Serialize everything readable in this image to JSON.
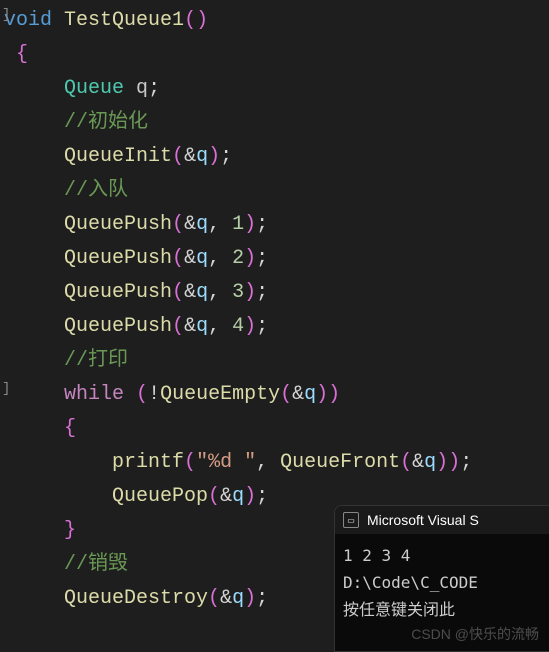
{
  "code": {
    "l1": {
      "kw": "void",
      "fn": "TestQueue1",
      "paren": "()"
    },
    "l2": "{",
    "l3": {
      "type": "Queue",
      "var": "q",
      "semi": ";"
    },
    "l4": "//初始化",
    "l5": {
      "fn": "QueueInit",
      "open": "(",
      "amp": "&",
      "arg": "q",
      "close": ")",
      "semi": ";"
    },
    "l6": "//入队",
    "l7": {
      "fn": "QueuePush",
      "open": "(",
      "amp": "&",
      "arg": "q",
      "comma": ", ",
      "n": "1",
      "close": ")",
      "semi": ";"
    },
    "l8": {
      "fn": "QueuePush",
      "open": "(",
      "amp": "&",
      "arg": "q",
      "comma": ", ",
      "n": "2",
      "close": ")",
      "semi": ";"
    },
    "l9": {
      "fn": "QueuePush",
      "open": "(",
      "amp": "&",
      "arg": "q",
      "comma": ", ",
      "n": "3",
      "close": ")",
      "semi": ";"
    },
    "l10": {
      "fn": "QueuePush",
      "open": "(",
      "amp": "&",
      "arg": "q",
      "comma": ", ",
      "n": "4",
      "close": ")",
      "semi": ";"
    },
    "l11": "//打印",
    "l12": {
      "kw": "while",
      "sp": " ",
      "open": "(",
      "not": "!",
      "fn": "QueueEmpty",
      "open2": "(",
      "amp": "&",
      "arg": "q",
      "close2": ")",
      "close": ")"
    },
    "l13": "{",
    "l14": {
      "fn": "printf",
      "open": "(",
      "str": "\"%d \"",
      "comma": ", ",
      "fn2": "QueueFront",
      "open2": "(",
      "amp": "&",
      "arg": "q",
      "close2": ")",
      "close": ")",
      "semi": ";"
    },
    "l15": {
      "fn": "QueuePop",
      "open": "(",
      "amp": "&",
      "arg": "q",
      "close": ")",
      "semi": ";"
    },
    "l16": "}",
    "l17": "//销毁",
    "l18": {
      "fn": "QueueDestroy",
      "open": "(",
      "amp": "&",
      "arg": "q",
      "close": ")",
      "semi": ";"
    }
  },
  "console": {
    "title": "Microsoft Visual S",
    "out_line1": "1 2 3 4",
    "out_line2": "D:\\Code\\C_CODE",
    "out_line3": "按任意键关闭此"
  },
  "watermark": "CSDN @快乐的流畅"
}
